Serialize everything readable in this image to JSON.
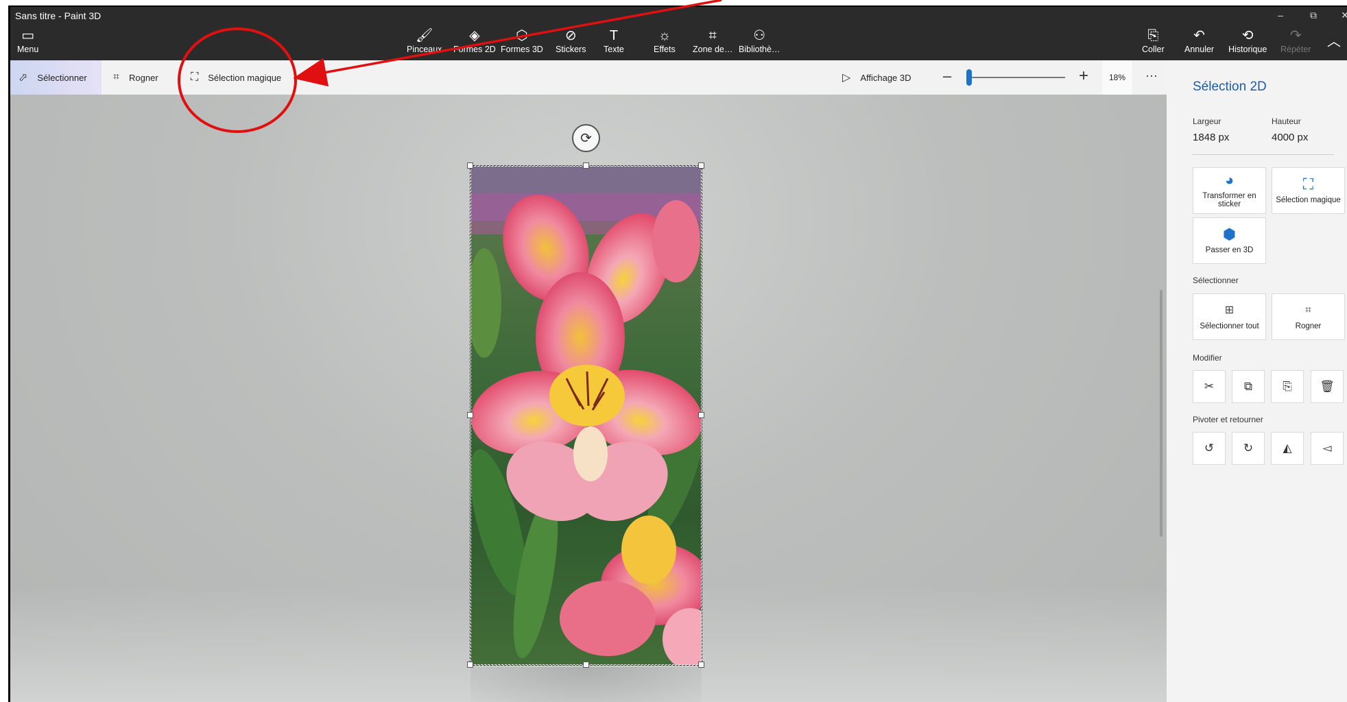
{
  "window": {
    "title": "Sans titre - Paint 3D"
  },
  "ribbon": {
    "menu": "Menu",
    "brushes": "Pinceaux",
    "shapes2d": "Formes 2D",
    "shapes3d": "Formes 3D",
    "stickers": "Stickers",
    "text": "Texte",
    "effects": "Effets",
    "canvas": "Zone de…",
    "library": "Bibliothè…",
    "paste": "Coller",
    "undo": "Annuler",
    "history": "Historique",
    "redo": "Répéter"
  },
  "toolbar": {
    "select": "Sélectionner",
    "crop": "Rogner",
    "magic_select": "Sélection magique",
    "view3d": "Affichage 3D",
    "zoom": "18%",
    "zoom_level": 0.02
  },
  "panel": {
    "title": "Sélection 2D",
    "width_label": "Largeur",
    "width_value": "1848 px",
    "height_label": "Hauteur",
    "height_value": "4000 px",
    "make_sticker": "Transformer en sticker",
    "magic_select": "Sélection magique",
    "make_3d": "Passer en 3D",
    "select_section": "Sélectionner",
    "select_all": "Sélectionner tout",
    "crop": "Rogner",
    "edit_section": "Modifier",
    "rotate_section": "Pivoter et retourner"
  },
  "icons": {
    "menu": "folder-icon",
    "brushes": "brush-icon",
    "shapes2d": "shapes-2d-icon",
    "shapes3d": "cube-icon",
    "stickers": "sticker-icon",
    "text": "text-icon",
    "effects": "sun-icon",
    "canvas": "canvas-crop-icon",
    "library": "library-icon"
  },
  "colors": {
    "accent": "#1e73c9",
    "annotation": "#e01010",
    "topbar": "#2b2b2b"
  }
}
